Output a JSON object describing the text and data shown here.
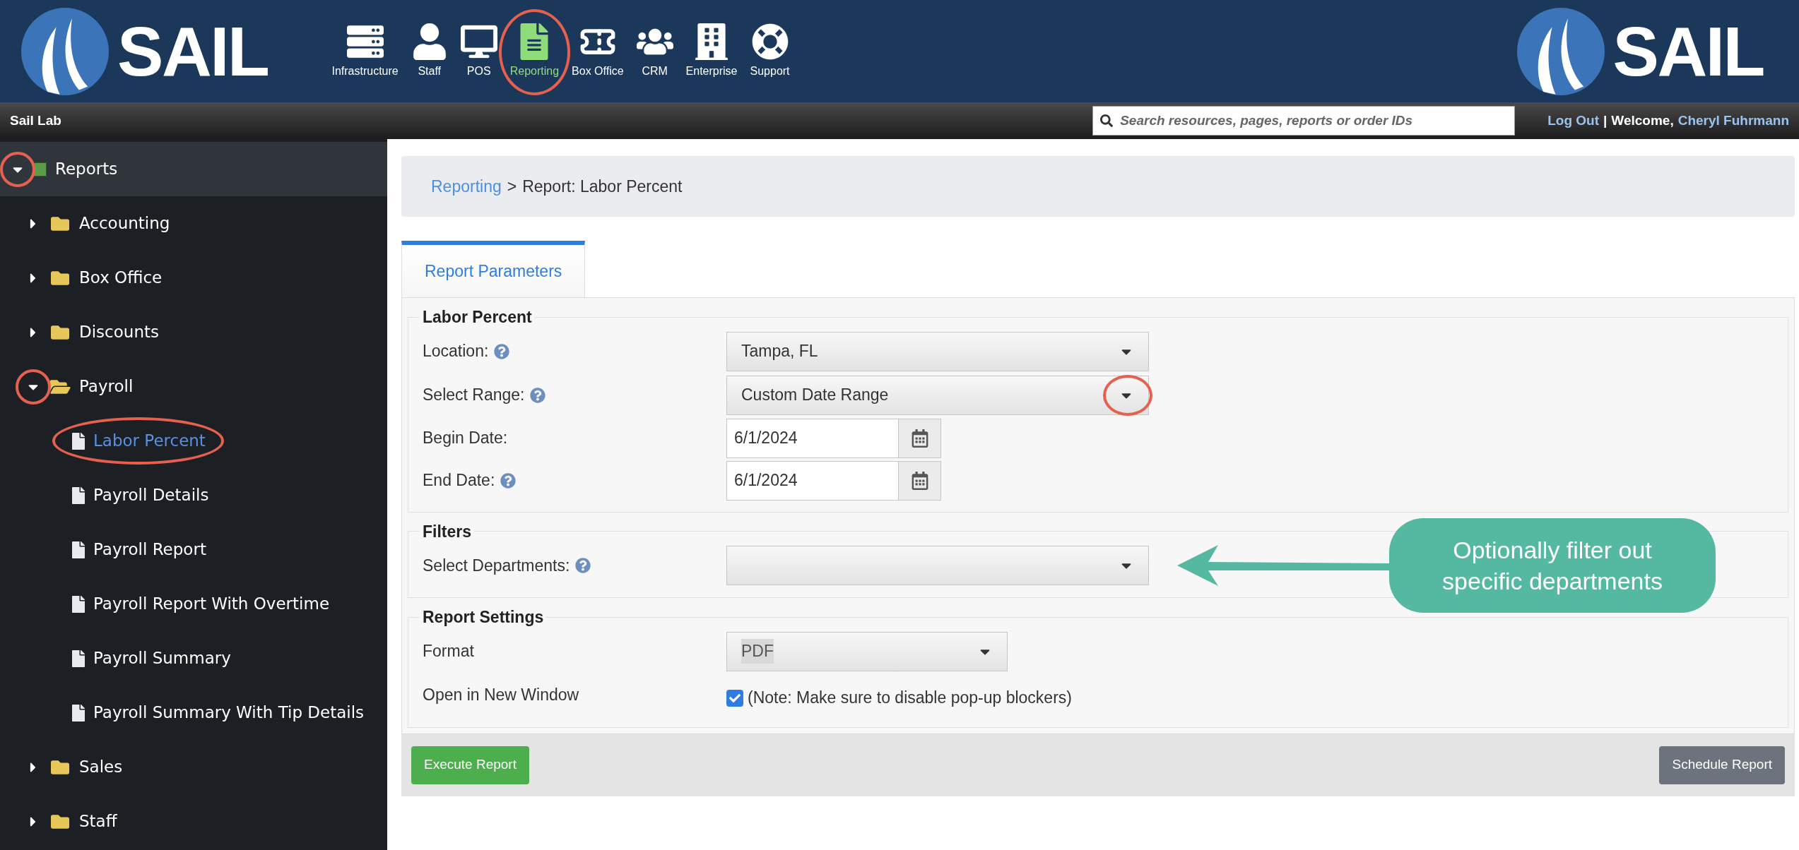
{
  "header": {
    "logo_left": "SAIL",
    "logo_right": "SAIL",
    "nav": [
      {
        "label": "Infrastructure",
        "selected": false
      },
      {
        "label": "Staff",
        "selected": false
      },
      {
        "label": "POS",
        "selected": false
      },
      {
        "label": "Reporting",
        "selected": true
      },
      {
        "label": "Box Office",
        "selected": false
      },
      {
        "label": "CRM",
        "selected": false
      },
      {
        "label": "Enterprise",
        "selected": false
      },
      {
        "label": "Support",
        "selected": false
      }
    ]
  },
  "top_bar": {
    "site_name": "Sail Lab",
    "search": {
      "placeholder": "Search resources, pages, reports or order IDs"
    },
    "logout": "Log Out",
    "separator": "|",
    "welcome": "Welcome,",
    "user": "Cheryl Fuhrmann"
  },
  "sidebar": {
    "tree": [
      {
        "label": "Reports",
        "kind": "root",
        "expanded": true,
        "children": [
          {
            "label": "Accounting",
            "kind": "folder",
            "expanded": false
          },
          {
            "label": "Box Office",
            "kind": "folder",
            "expanded": false
          },
          {
            "label": "Discounts",
            "kind": "folder",
            "expanded": false
          },
          {
            "label": "Payroll",
            "kind": "folder",
            "expanded": true,
            "children": [
              {
                "label": "Labor Percent",
                "kind": "report",
                "selected": true
              },
              {
                "label": "Payroll Details",
                "kind": "report",
                "selected": false
              },
              {
                "label": "Payroll Report",
                "kind": "report",
                "selected": false
              },
              {
                "label": "Payroll Report With Overtime",
                "kind": "report",
                "selected": false
              },
              {
                "label": "Payroll Summary",
                "kind": "report",
                "selected": false
              },
              {
                "label": "Payroll Summary With Tip Details",
                "kind": "report",
                "selected": false
              }
            ]
          },
          {
            "label": "Sales",
            "kind": "folder",
            "expanded": false
          },
          {
            "label": "Staff",
            "kind": "folder",
            "expanded": false
          }
        ]
      }
    ]
  },
  "breadcrumb": {
    "link": "Reporting",
    "separator": ">",
    "current": "Report: Labor Percent"
  },
  "tabs": [
    {
      "label": "Report Parameters",
      "selected": true
    }
  ],
  "sections": [
    {
      "title": "Labor Percent",
      "fields": [
        {
          "label": "Location:",
          "help": true,
          "kind": "select",
          "value": "Tampa, FL"
        },
        {
          "label": "Select Range:",
          "help": true,
          "kind": "select",
          "value": "Custom Date Range"
        },
        {
          "label": "Begin Date:",
          "help": false,
          "kind": "date",
          "value": "6/1/2024"
        },
        {
          "label": "End Date:",
          "help": true,
          "kind": "date",
          "value": "6/1/2024"
        }
      ]
    },
    {
      "title": "Filters",
      "fields": [
        {
          "label": "Select Departments:",
          "help": true,
          "kind": "select",
          "callout": "Optionally filter out specific departments"
        }
      ]
    },
    {
      "title": "Report Settings",
      "fields": [
        {
          "label": "Format",
          "help": false,
          "kind": "shortselect",
          "value": "PDF"
        },
        {
          "label": "Open in New Window",
          "help": false,
          "kind": "checkbox",
          "checked": true,
          "note": "(Note: Make sure to disable pop-up blockers)"
        }
      ]
    }
  ],
  "actions": [
    {
      "label": "Execute Report",
      "kind": "primary"
    },
    {
      "label": "Schedule Report",
      "kind": "secondary"
    }
  ]
}
